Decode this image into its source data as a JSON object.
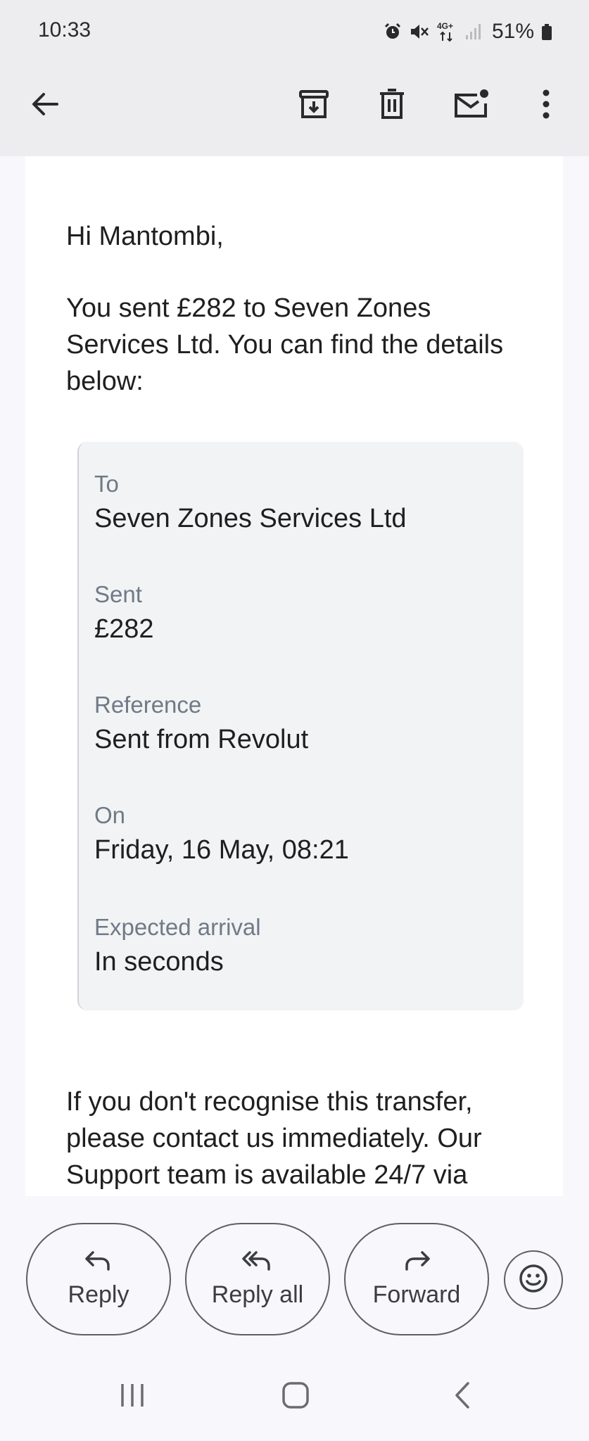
{
  "status_bar": {
    "time": "10:33",
    "network": "4G+",
    "battery": "51%"
  },
  "app_bar": {
    "icons": [
      "back-arrow-icon",
      "archive-icon",
      "delete-icon",
      "mark-unread-icon",
      "more-options-icon"
    ]
  },
  "email": {
    "greeting": "Hi Mantombi,",
    "intro": "You sent £282 to Seven Zones Services Ltd. You can find the details below:",
    "details": [
      {
        "label": "To",
        "value": "Seven Zones Services Ltd"
      },
      {
        "label": "Sent",
        "value": "£282"
      },
      {
        "label": "Reference",
        "value": "Sent from Revolut"
      },
      {
        "label": "On",
        "value": "Friday, 16 May, 08:21"
      },
      {
        "label": "Expected arrival",
        "value": "In seconds"
      }
    ],
    "footer": "If you don't recognise this transfer, please contact us immediately. Our Support team is available 24/7 via"
  },
  "actions": {
    "reply": "Reply",
    "reply_all": "Reply all",
    "forward": "Forward"
  },
  "colors": {
    "header_bg": "#ededf0",
    "page_bg": "#f7f7fc",
    "card_bg": "#ffffff",
    "details_bg": "#f2f3f5",
    "label_gray": "#6f7a86"
  }
}
